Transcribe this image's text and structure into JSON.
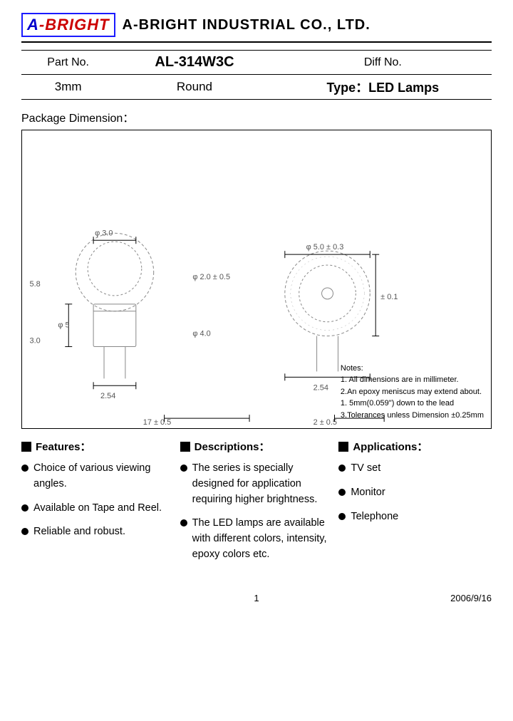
{
  "header": {
    "logo_text_a": "A",
    "logo_text_bright": "-BRIGHT",
    "company_name": "A-BRIGHT INDUSTRIAL CO., LTD."
  },
  "part_info": {
    "part_no_label": "Part No.",
    "part_no_value": "AL-314W3C",
    "diff_no_label": "Diff No.",
    "size_label": "3mm",
    "shape_label": "Round",
    "type_label": "Type：LED Lamps"
  },
  "package_dimension": {
    "title": "Package Dimension：",
    "notes": {
      "heading": "Notes:",
      "line1": "1. All dimensions are in millimeter.",
      "line2": "2.An epoxy meniscus may extend about.",
      "line3": "   1. 5mm(0.059\") down to the lead",
      "line4": "3.Tolerances unless Dimension ±0.25mm"
    }
  },
  "features": {
    "header": "Features：",
    "items": [
      "Choice of various viewing angles.",
      "Available on Tape and Reel.",
      "Reliable and robust."
    ]
  },
  "descriptions": {
    "header": "Descriptions：",
    "items": [
      "The series is specially designed for application requiring higher brightness.",
      "The LED lamps are available with different colors, intensity, epoxy colors etc."
    ]
  },
  "applications": {
    "header": "Applications：",
    "items": [
      "TV set",
      "Monitor",
      "Telephone"
    ]
  },
  "footer": {
    "page_number": "1",
    "date": "2006/9/16"
  }
}
